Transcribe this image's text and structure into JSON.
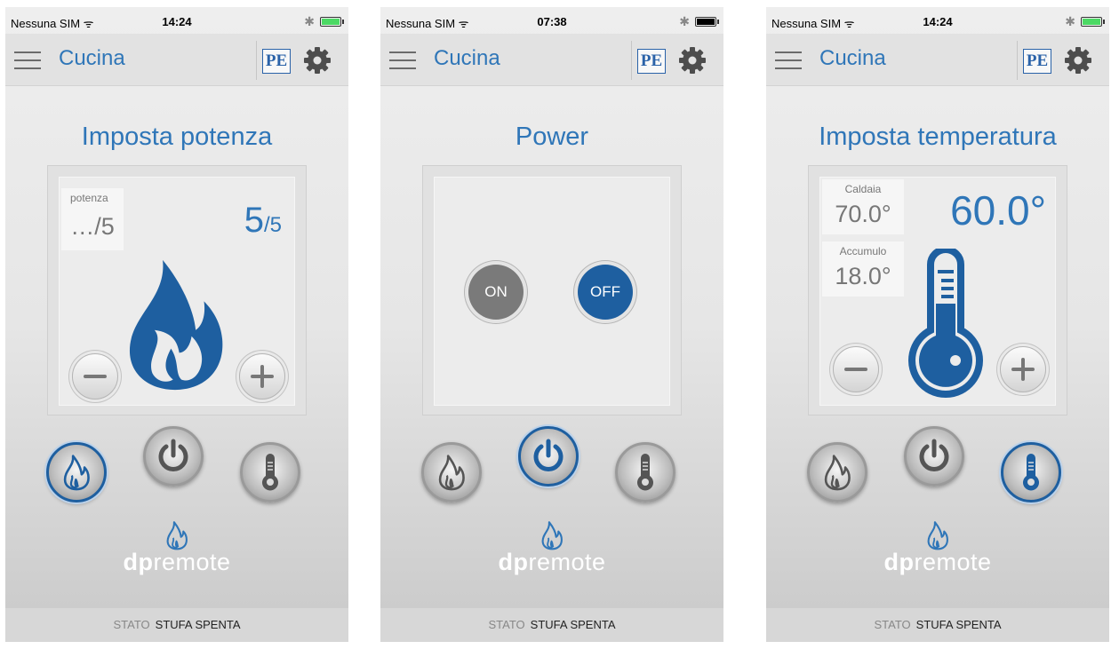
{
  "status_bar": {
    "carrier": "Nessuna SIM ᯤ",
    "bluetooth": "✱"
  },
  "app": {
    "title": "Cucina",
    "logo": "PE"
  },
  "footer": {
    "label": "STATO",
    "value": "STUFA SPENTA"
  },
  "brand": {
    "bold": "dp",
    "light": "remote"
  },
  "screens": [
    {
      "time": "14:24",
      "battery_color": "#4cd964",
      "title": "Imposta potenza",
      "potenza_label": "potenza",
      "potenza_value": "…/5",
      "big_value": "5",
      "big_suffix": "/5",
      "active_tab": "power-level"
    },
    {
      "time": "07:38",
      "battery_color": "#000000",
      "title": "Power",
      "on_label": "ON",
      "off_label": "OFF",
      "selected": "OFF",
      "active_tab": "on-off"
    },
    {
      "time": "14:24",
      "battery_color": "#4cd964",
      "title": "Imposta temperatura",
      "caldaia_label": "Caldaia",
      "caldaia_value": "70.0°",
      "accumulo_label": "Accumulo",
      "accumulo_value": "18.0°",
      "big_value": "60.0°",
      "active_tab": "temperature"
    }
  ],
  "colors": {
    "accent": "#2f76b8",
    "dark_blue": "#1e5fa0",
    "grey_button": "#7a7a7a"
  },
  "icons": [
    "menu-icon",
    "gear-icon",
    "flame-icon",
    "power-icon",
    "thermometer-icon",
    "minus-icon",
    "plus-icon"
  ]
}
